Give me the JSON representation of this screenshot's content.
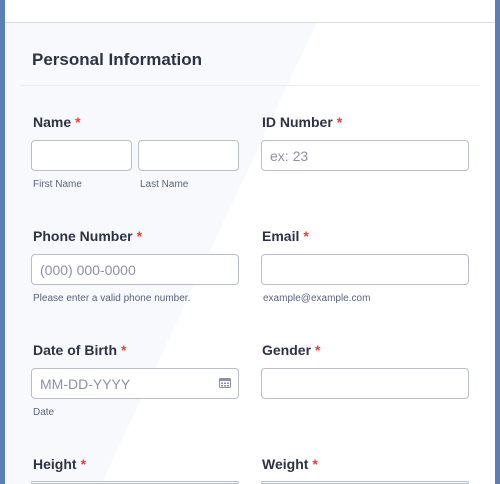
{
  "section": {
    "title": "Personal Information"
  },
  "fields": {
    "name": {
      "label": "Name",
      "first_sub": "First Name",
      "last_sub": "Last Name"
    },
    "id_number": {
      "label": "ID Number",
      "placeholder": "ex: 23"
    },
    "phone": {
      "label": "Phone Number",
      "placeholder": "(000) 000-0000",
      "sub": "Please enter a valid phone number."
    },
    "email": {
      "label": "Email",
      "sub": "example@example.com"
    },
    "dob": {
      "label": "Date of Birth",
      "placeholder": "MM-DD-YYYY",
      "sub": "Date",
      "icon": "calendar-icon"
    },
    "gender": {
      "label": "Gender"
    },
    "height": {
      "label": "Height"
    },
    "weight": {
      "label": "Weight"
    }
  },
  "required_mark": "*",
  "colors": {
    "accent_border": "#5a7fb6",
    "required": "#f23a3c",
    "input_border": "#b8bdc9"
  }
}
